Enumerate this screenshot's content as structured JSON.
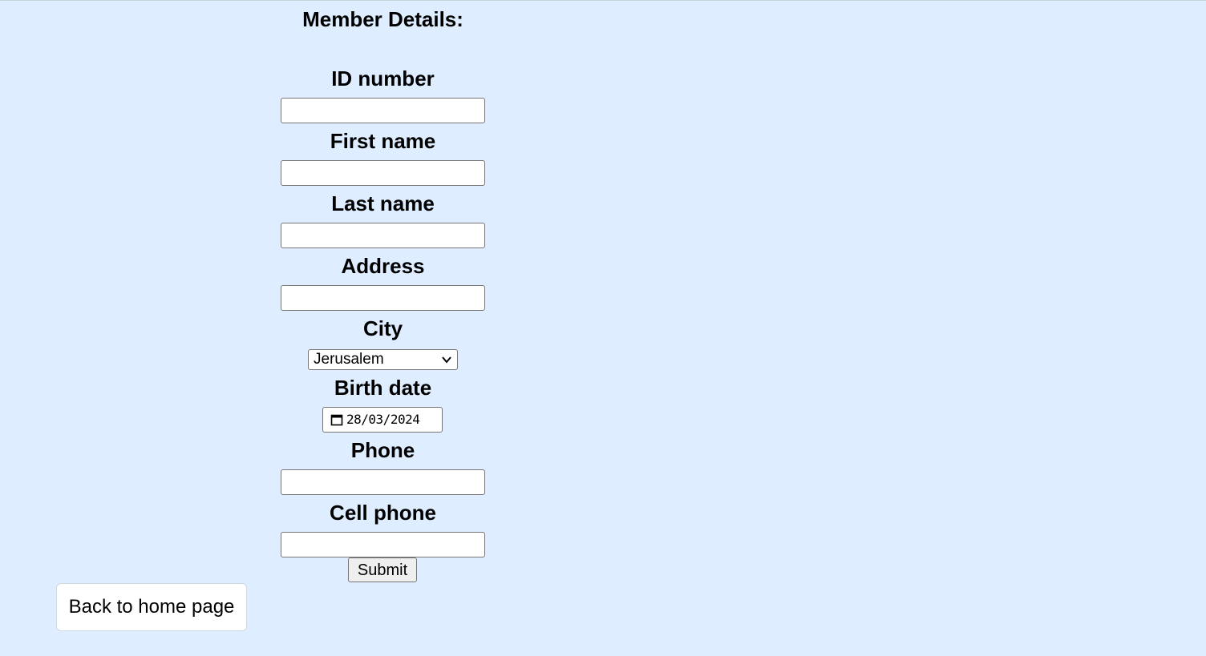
{
  "form": {
    "title": "Member Details:",
    "fields": {
      "id_number": {
        "label": "ID number",
        "value": ""
      },
      "first_name": {
        "label": "First name",
        "value": ""
      },
      "last_name": {
        "label": "Last name",
        "value": ""
      },
      "address": {
        "label": "Address",
        "value": ""
      },
      "city": {
        "label": "City",
        "selected": "Jerusalem"
      },
      "birth_date": {
        "label": "Birth date",
        "day": "28",
        "month": "03",
        "year": "2024",
        "separator": "/"
      },
      "phone": {
        "label": "Phone",
        "value": ""
      },
      "cell_phone": {
        "label": "Cell phone",
        "value": ""
      }
    },
    "submit_label": "Submit"
  },
  "navigation": {
    "back_label": "Back to home page"
  },
  "icons": {
    "city_dropdown": "chevron-down-icon",
    "birth_date_picker": "calendar-icon"
  },
  "colors": {
    "page_background": "#deedff",
    "input_background": "#ffffff",
    "button_background": "#efefef"
  }
}
